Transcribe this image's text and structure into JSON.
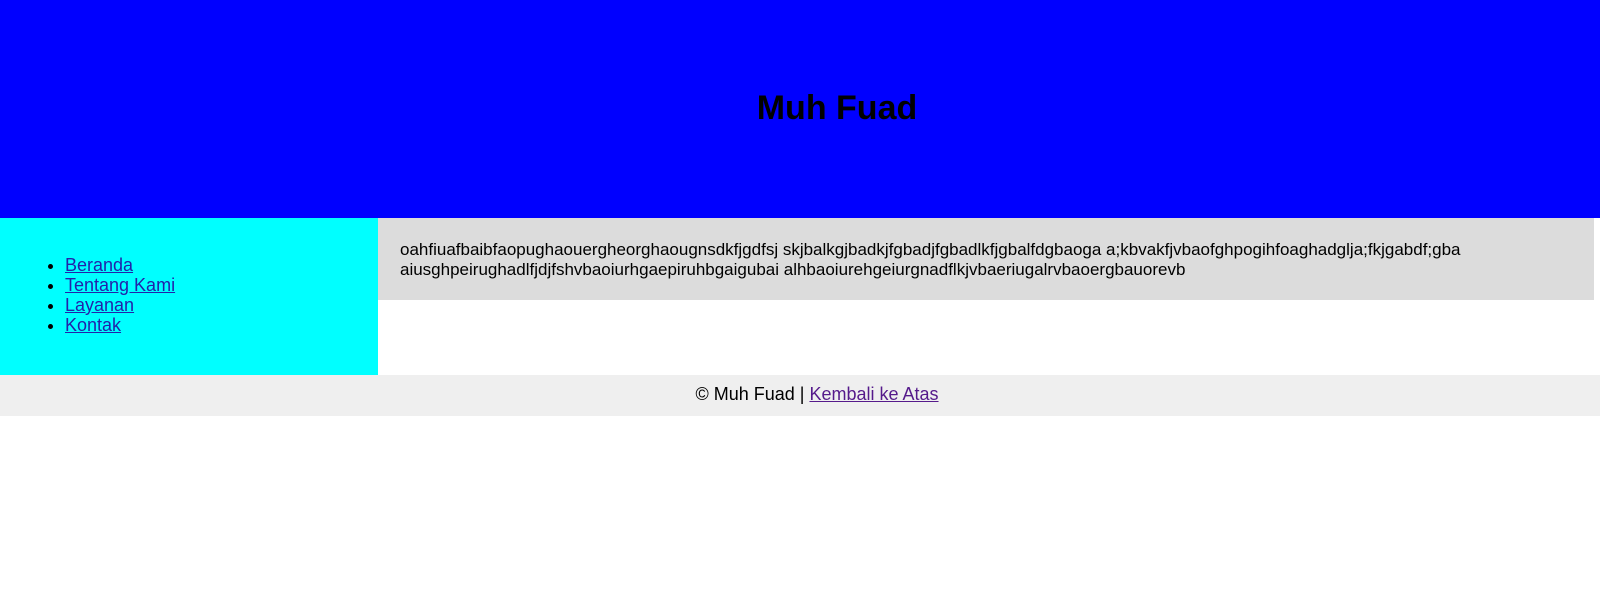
{
  "header": {
    "title": "Muh Fuad"
  },
  "sidebar": {
    "items": [
      {
        "label": "Beranda"
      },
      {
        "label": "Tentang Kami"
      },
      {
        "label": "Layanan"
      },
      {
        "label": "Kontak"
      }
    ]
  },
  "main": {
    "text": "oahfiuafbaibfaopughaouergheorghaougnsdkfjgdfsj skjbalkgjbadkjfgbadjfgbadlkfjgbalfdgbaoga a;kbvakfjvbaofghpogihfoaghadglja;fkjgabdf;gba aiusghpeirughadlfjdjfshvbaoiurhgaepiruhbgaigubai alhbaoiurehgeiurgnadflkjvbaeriugalrvbaoergbauorevb"
  },
  "footer": {
    "copyright": "© Muh Fuad |",
    "back_to_top_label": "Kembali ke Atas"
  },
  "colors": {
    "header_bg": "#0000ff",
    "sidebar_bg": "#00ffff",
    "content_bg": "#dcdcdc",
    "footer_bg": "#efefef",
    "link": "#2222aa",
    "visited_link": "#551a8b"
  }
}
